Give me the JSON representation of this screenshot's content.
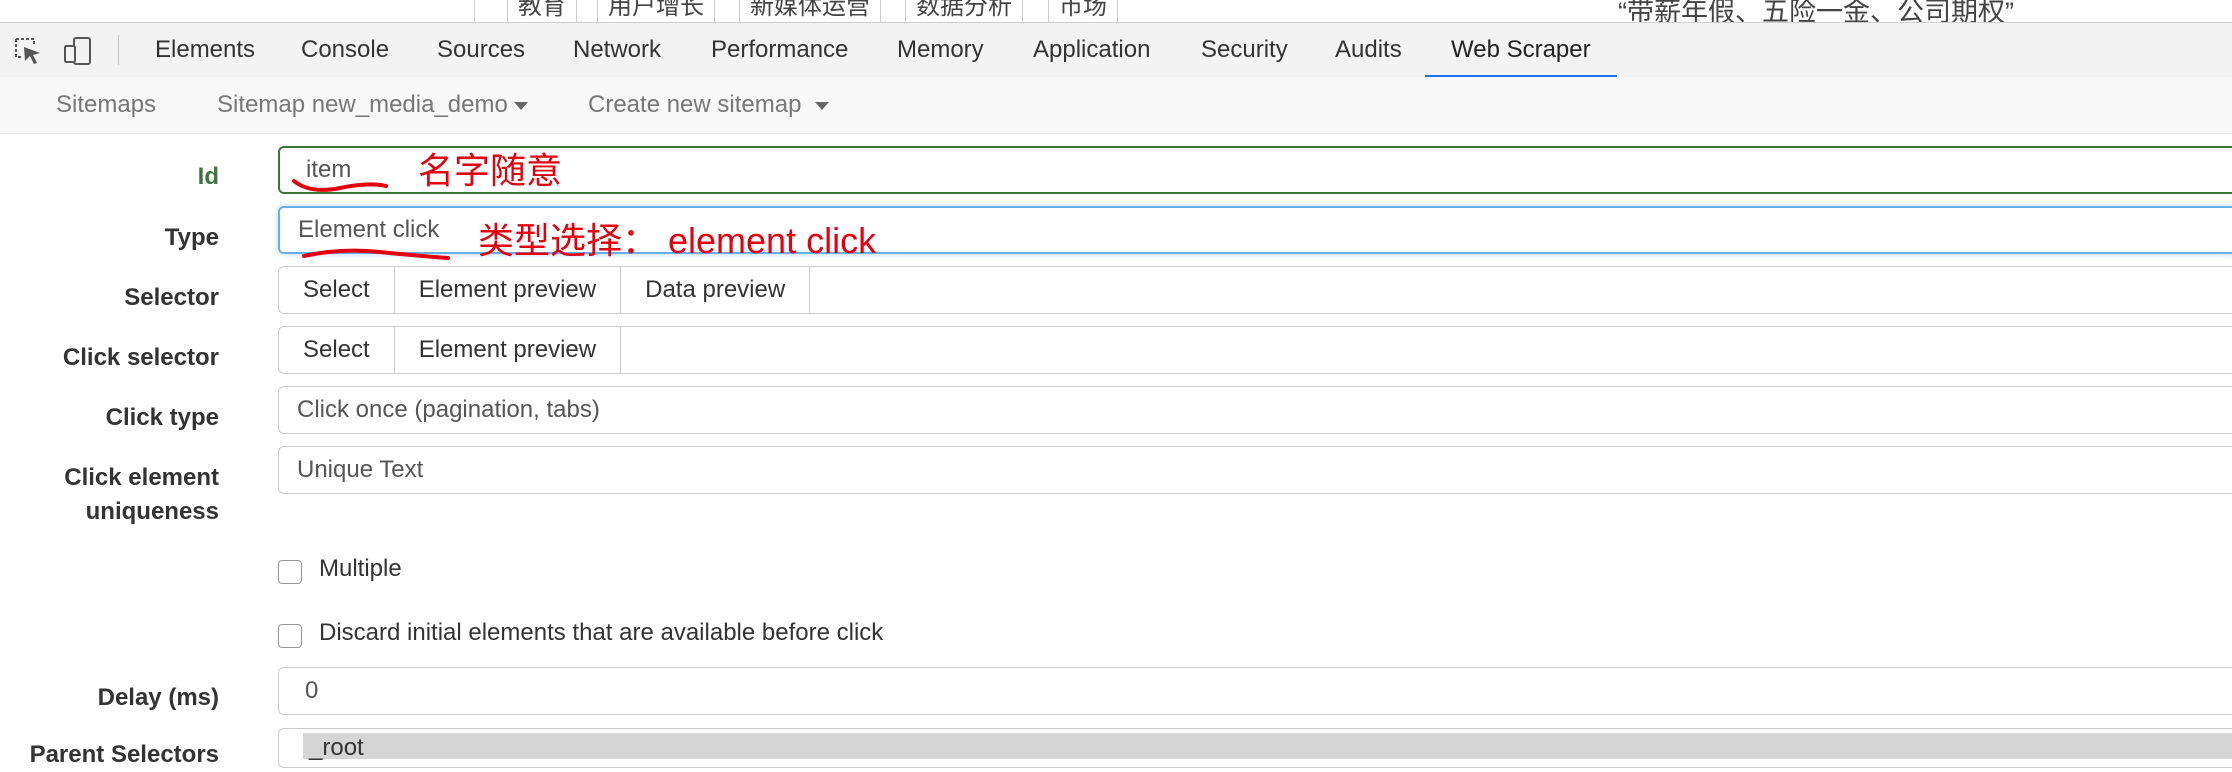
{
  "page_strip": {
    "cells": [
      "教育",
      "用户增长",
      "新媒体运营",
      "数据分析",
      "市场"
    ],
    "quote": "“带薪年假、五险一金、公司期权”"
  },
  "devtools": {
    "tabs": [
      "Elements",
      "Console",
      "Sources",
      "Network",
      "Performance",
      "Memory",
      "Application",
      "Security",
      "Audits",
      "Web Scraper"
    ],
    "active_tab": "Web Scraper",
    "accent_color": "#1a73e8"
  },
  "subnav": {
    "sitemaps": "Sitemaps",
    "sitemap_current": "Sitemap new_media_demo",
    "create_new": "Create new sitemap"
  },
  "form": {
    "id_label": "Id",
    "id_value": "item",
    "type_label": "Type",
    "type_value": "Element click",
    "selector_label": "Selector",
    "selector_buttons": [
      "Select",
      "Element preview",
      "Data preview"
    ],
    "click_selector_label": "Click selector",
    "click_selector_buttons": [
      "Select",
      "Element preview"
    ],
    "click_type_label": "Click type",
    "click_type_value": "Click once (pagination, tabs)",
    "uniqueness_label_1": "Click element",
    "uniqueness_label_2": "uniqueness",
    "uniqueness_value": "Unique Text",
    "multiple_label": "Multiple",
    "discard_label": "Discard initial elements that are available before click",
    "delay_label": "Delay (ms)",
    "delay_value": "0",
    "parent_label": "Parent Selectors",
    "parent_value": "_root"
  },
  "annotations": {
    "id_note": "名字随意",
    "type_note": "类型选择：  element click",
    "color": "#e3000f"
  }
}
